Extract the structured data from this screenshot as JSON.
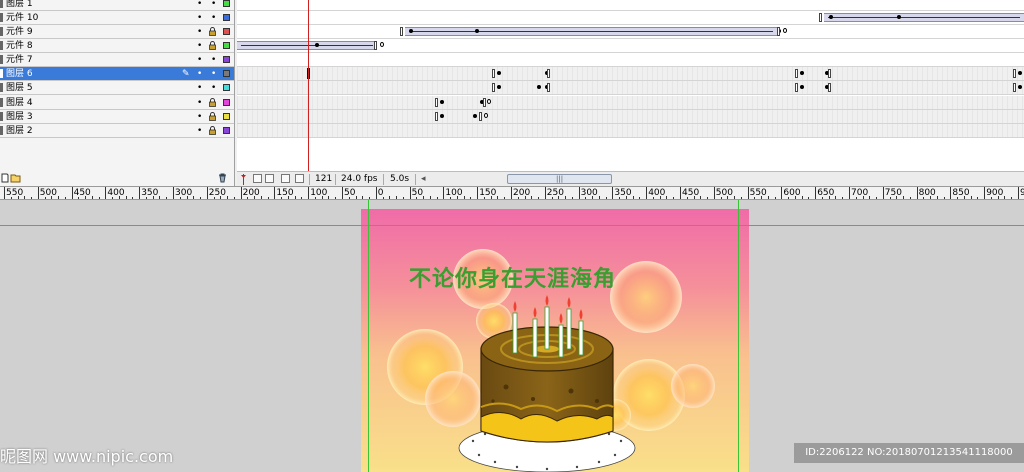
{
  "timeline": {
    "layers": [
      {
        "name": "图层 1",
        "color": "#44dd44",
        "selected": false,
        "locked": false
      },
      {
        "name": "元件 10",
        "color": "#3a6ee0",
        "selected": false,
        "locked": false
      },
      {
        "name": "元件 9",
        "color": "#e05050",
        "selected": false,
        "locked": true
      },
      {
        "name": "元件 8",
        "color": "#44dd44",
        "selected": false,
        "locked": true
      },
      {
        "name": "元件 7",
        "color": "#8a44d8",
        "selected": false,
        "locked": false
      },
      {
        "name": "图层 6",
        "color": "#7a7a7a",
        "selected": true,
        "locked": false
      },
      {
        "name": "图层 5",
        "color": "#44dddd",
        "selected": false,
        "locked": false
      },
      {
        "name": "图层 4",
        "color": "#e044d8",
        "selected": false,
        "locked": true
      },
      {
        "name": "图层 3",
        "color": "#e8e044",
        "selected": false,
        "locked": true
      },
      {
        "name": "图层 2",
        "color": "#8a44d8",
        "selected": false,
        "locked": true
      }
    ],
    "eye_glyph": "•",
    "lock_glyph": "•",
    "pencil_glyph": "✎",
    "current_frame": "121",
    "frame_rate": "24.0 fps",
    "elapsed_time": "5.0s",
    "scroll_left_arrow": "◂",
    "scroll_grip": "|||"
  },
  "ruler": {
    "labels": [
      "550",
      "500",
      "450",
      "400",
      "350",
      "300",
      "250",
      "200",
      "150",
      "100",
      "50",
      "0",
      "50",
      "100",
      "150",
      "200",
      "250",
      "300",
      "350",
      "400",
      "450",
      "500",
      "550",
      "600",
      "650",
      "700",
      "750",
      "800",
      "850",
      "900",
      "950"
    ]
  },
  "stage": {
    "title_text": "不论你身在天涯海角",
    "title_color": "#3a9e30",
    "guide_color": "#37c437"
  },
  "overlay": {
    "watermark": "昵图网 www.nipic.com",
    "image_id": "ID:2206122 NO:20180701213541118000"
  }
}
